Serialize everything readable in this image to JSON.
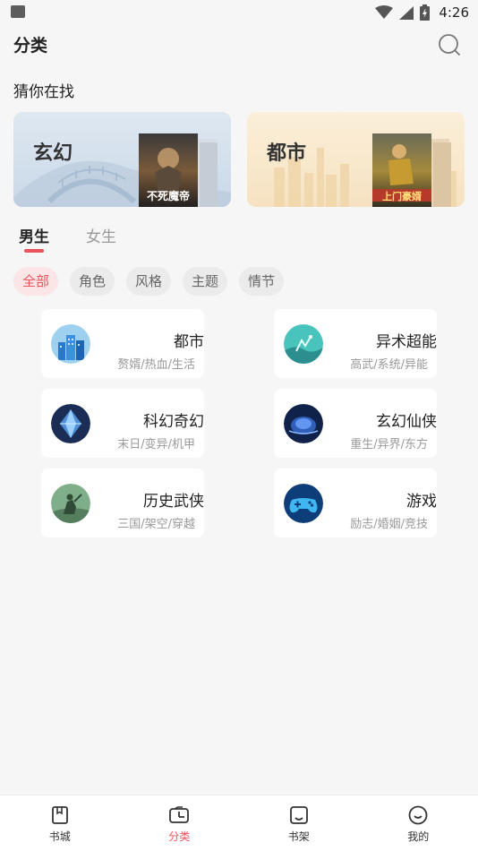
{
  "status_bar": {
    "time": "4:26"
  },
  "header": {
    "title": "分类"
  },
  "suggest": {
    "title": "猜你在找",
    "banners": [
      {
        "label": "玄幻",
        "book_cover_text": "不死魔帝"
      },
      {
        "label": "都市",
        "book_cover_text": "上门豪婿"
      }
    ]
  },
  "gender_tabs": [
    {
      "label": "男生",
      "selected": true
    },
    {
      "label": "女生",
      "selected": false
    }
  ],
  "filter_chips": [
    {
      "label": "全部",
      "selected": true
    },
    {
      "label": "角色",
      "selected": false
    },
    {
      "label": "风格",
      "selected": false
    },
    {
      "label": "主题",
      "selected": false
    },
    {
      "label": "情节",
      "selected": false
    }
  ],
  "categories": [
    {
      "name": "都市",
      "tags": "赘婿/热血/生活",
      "icon": "city-icon"
    },
    {
      "name": "异术超能",
      "tags": "高武/系统/异能",
      "icon": "superpower-icon"
    },
    {
      "name": "科幻奇幻",
      "tags": "末日/变异/机甲",
      "icon": "scifi-icon"
    },
    {
      "name": "玄幻仙侠",
      "tags": "重生/异界/东方",
      "icon": "fantasy-icon"
    },
    {
      "name": "历史武侠",
      "tags": "三国/架空/穿越",
      "icon": "history-icon"
    },
    {
      "name": "游戏",
      "tags": "励志/婚姻/竞技",
      "icon": "gamepad-icon"
    }
  ],
  "bottom_nav": [
    {
      "label": "书城",
      "icon": "bookstore-icon",
      "active": false
    },
    {
      "label": "分类",
      "icon": "category-icon",
      "active": true
    },
    {
      "label": "书架",
      "icon": "bookshelf-icon",
      "active": false
    },
    {
      "label": "我的",
      "icon": "profile-icon",
      "active": false
    }
  ],
  "colors": {
    "accent": "#e8545c",
    "background": "#f6f6f7",
    "chip_bg": "#ebebeb"
  }
}
